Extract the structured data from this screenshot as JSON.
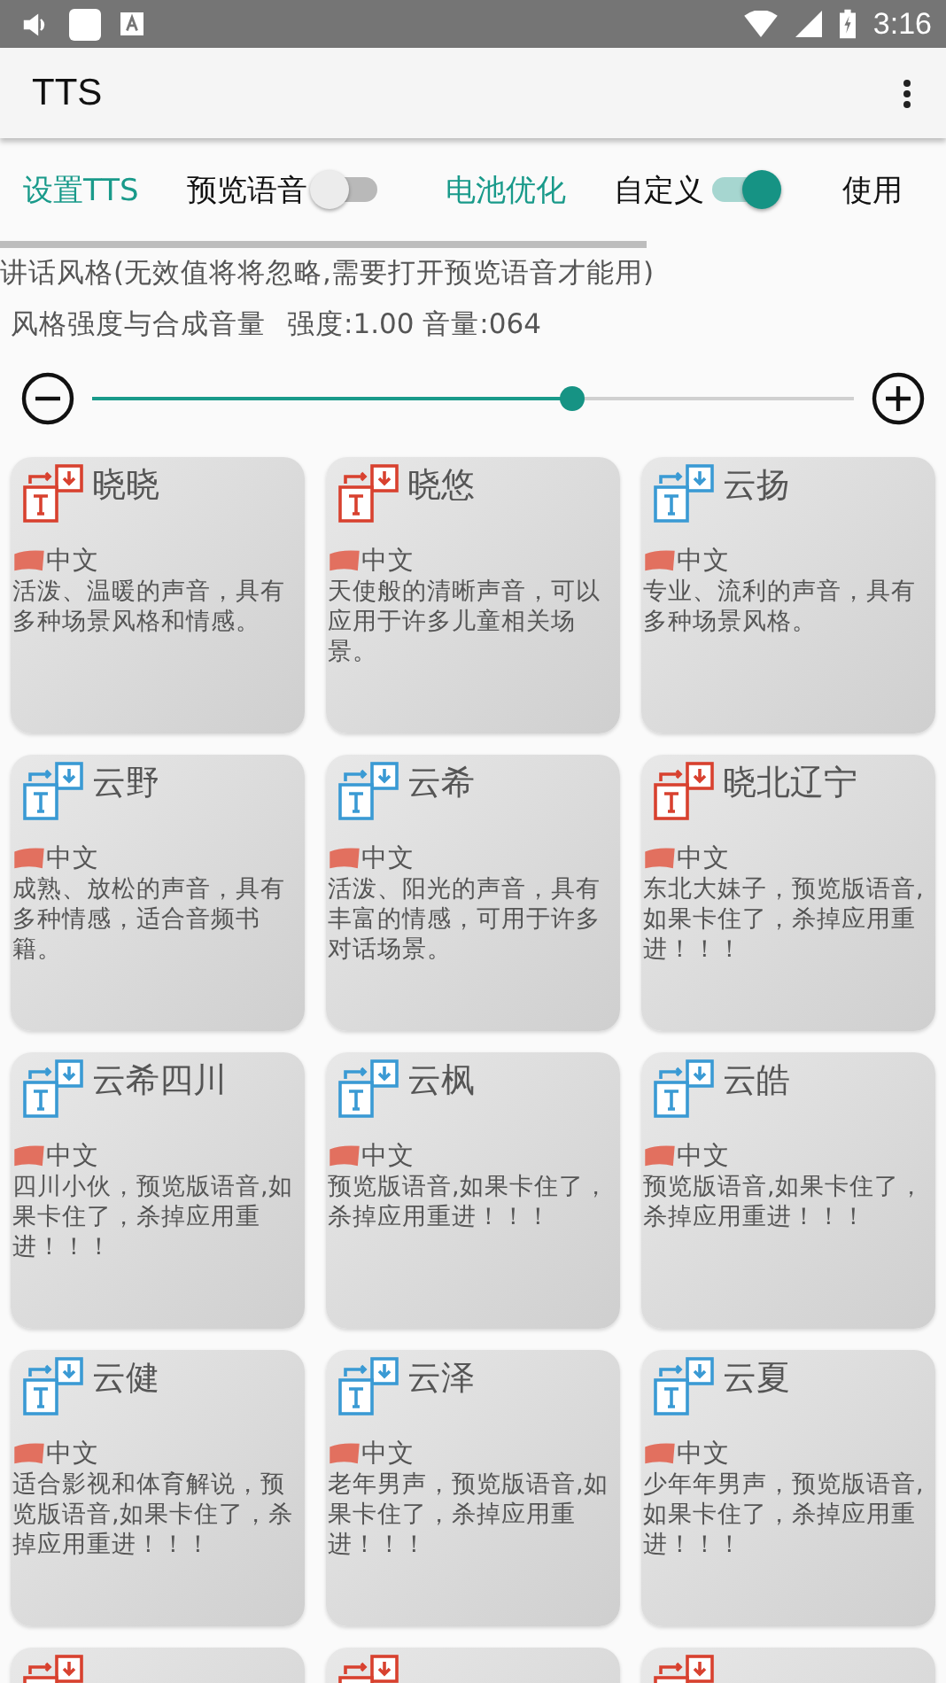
{
  "status_bar": {
    "time": "3:16"
  },
  "app_bar": {
    "title": "TTS"
  },
  "toolbar": [
    {
      "kind": "button",
      "label": "设置TTS"
    },
    {
      "kind": "switch",
      "label": "预览语音",
      "on": false
    },
    {
      "kind": "button",
      "label": "电池优化"
    },
    {
      "kind": "switch",
      "label": "自定义",
      "on": true
    },
    {
      "kind": "label",
      "label": "使用"
    }
  ],
  "style_note": "讲话风格(无效值将将忽略,需要打开预览语音才能用)",
  "strength": {
    "label": "风格强度与合成音量",
    "reading": "强度:1.00 音量:064",
    "level": 0.63
  },
  "voices": [
    {
      "name": "晓晓",
      "color": "#d8412f",
      "language": "中文",
      "description": "活泼、温暖的声音，具有多种场景风格和情感。"
    },
    {
      "name": "晓悠",
      "color": "#d8412f",
      "language": "中文",
      "description": "天使般的清晰声音，可以应用于许多儿童相关场景。"
    },
    {
      "name": "云扬",
      "color": "#3a9ad4",
      "language": "中文",
      "description": "专业、流利的声音，具有多种场景风格。"
    },
    {
      "name": "云野",
      "color": "#3a9ad4",
      "language": "中文",
      "description": "成熟、放松的声音，具有多种情感，适合音频书籍。"
    },
    {
      "name": "云希",
      "color": "#3a9ad4",
      "language": "中文",
      "description": "活泼、阳光的声音，具有丰富的情感，可用于许多对话场景。"
    },
    {
      "name": "晓北辽宁",
      "color": "#d8412f",
      "language": "中文",
      "description": "东北大妹子，预览版语音,如果卡住了，杀掉应用重进！！！"
    },
    {
      "name": "云希四川",
      "color": "#3a9ad4",
      "language": "中文",
      "description": "四川小伙，预览版语音,如果卡住了，杀掉应用重进！！！"
    },
    {
      "name": "云枫",
      "color": "#3a9ad4",
      "language": "中文",
      "description": "预览版语音,如果卡住了，杀掉应用重进！！！"
    },
    {
      "name": "云皓",
      "color": "#3a9ad4",
      "language": "中文",
      "description": "预览版语音,如果卡住了，杀掉应用重进！！！"
    },
    {
      "name": "云健",
      "color": "#3a9ad4",
      "language": "中文",
      "description": "适合影视和体育解说，预览版语音,如果卡住了，杀掉应用重进！！！"
    },
    {
      "name": "云泽",
      "color": "#3a9ad4",
      "language": "中文",
      "description": "老年男声，预览版语音,如果卡住了，杀掉应用重进！！！"
    },
    {
      "name": "云夏",
      "color": "#3a9ad4",
      "language": "中文",
      "description": "少年年男声，预览版语音,如果卡住了，杀掉应用重进！！！"
    },
    {
      "color": "#d8412f"
    },
    {
      "color": "#d8412f"
    },
    {
      "color": "#d8412f"
    }
  ]
}
